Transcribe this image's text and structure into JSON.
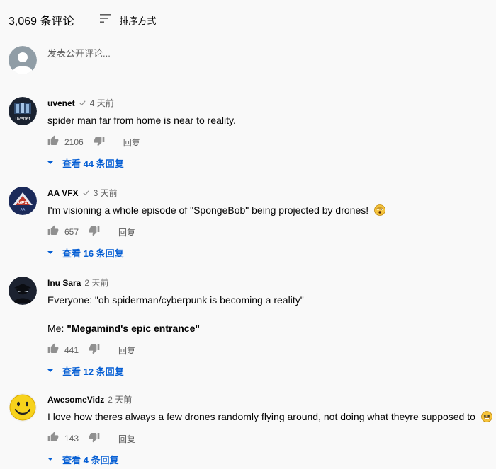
{
  "header": {
    "comment_count": "3,069 条评论",
    "sort_label": "排序方式"
  },
  "add_comment": {
    "placeholder": "发表公开评论..."
  },
  "colors": {
    "link_blue": "#065fd4",
    "secondary_text": "#606060",
    "background": "#f9f9f9"
  },
  "comments": [
    {
      "author": "uvenet",
      "verified": true,
      "time": "4 天前",
      "text": "spider man far from home is near to reality.",
      "likes": "2106",
      "reply_label": "回复",
      "replies_label": "查看 44 条回复"
    },
    {
      "author": "AA VFX",
      "verified": true,
      "time": "3 天前",
      "text": "I'm visioning a whole episode of \"SpongeBob\" being projected by drones!",
      "emoji": "astonished-emoji",
      "likes": "657",
      "reply_label": "回复",
      "replies_label": "查看 16 条回复"
    },
    {
      "author": "Inu Sara",
      "verified": false,
      "time": "2 天前",
      "text": "Everyone: \"oh spiderman/cyberpunk is becoming a reality\"",
      "text_line2_prefix": "Me: ",
      "text_line2_bold": "\"Megamind's epic entrance\"",
      "likes": "441",
      "reply_label": "回复",
      "replies_label": "查看 12 条回复"
    },
    {
      "author": "AwesomeVidz",
      "verified": false,
      "time": "2 天前",
      "text": "I love how theres always a few drones randomly flying around, not doing what theyre supposed to",
      "emoji": "grinning-sweat-emoji",
      "likes": "143",
      "reply_label": "回复",
      "replies_label": "查看 4 条回复"
    }
  ]
}
